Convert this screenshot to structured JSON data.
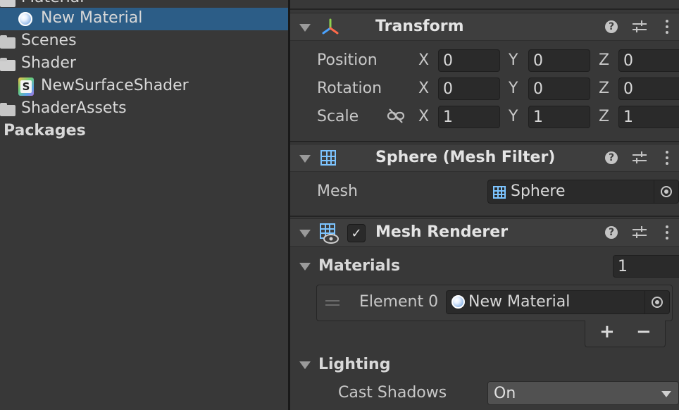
{
  "project": {
    "items": [
      {
        "label": "Material",
        "icon": "folder-open-icon"
      },
      {
        "label": "New Material",
        "icon": "material-icon",
        "selected": true
      },
      {
        "label": "Scenes",
        "icon": "folder-icon"
      },
      {
        "label": "Shader",
        "icon": "folder-open-icon"
      },
      {
        "label": "NewSurfaceShader",
        "icon": "shader-icon"
      },
      {
        "label": "ShaderAssets",
        "icon": "folder-icon"
      }
    ],
    "packages_label": "Packages",
    "selection_color": "#2c5d87"
  },
  "inspector": {
    "transform": {
      "title": "Transform",
      "position": {
        "label": "Position",
        "x": "0",
        "y": "0",
        "z": "0"
      },
      "rotation": {
        "label": "Rotation",
        "x": "0",
        "y": "0",
        "z": "0"
      },
      "scale": {
        "label": "Scale",
        "x": "1",
        "y": "1",
        "z": "1"
      },
      "axes": {
        "x": "X",
        "y": "Y",
        "z": "Z"
      }
    },
    "mesh_filter": {
      "title": "Sphere (Mesh Filter)",
      "mesh_label": "Mesh",
      "mesh_value": "Sphere"
    },
    "mesh_renderer": {
      "title": "Mesh Renderer",
      "enabled": true,
      "materials_label": "Materials",
      "materials_count": "1",
      "element_label": "Element 0",
      "element_value": "New Material",
      "add_label": "+",
      "remove_label": "−",
      "lighting_label": "Lighting",
      "cast_shadows_label": "Cast Shadows",
      "cast_shadows_value": "On"
    }
  },
  "colors": {
    "panel_bg": "#383838",
    "header_bg": "#3e3e3e",
    "field_bg": "#2a2a2a",
    "accent_blue": "#7cc4ff"
  }
}
